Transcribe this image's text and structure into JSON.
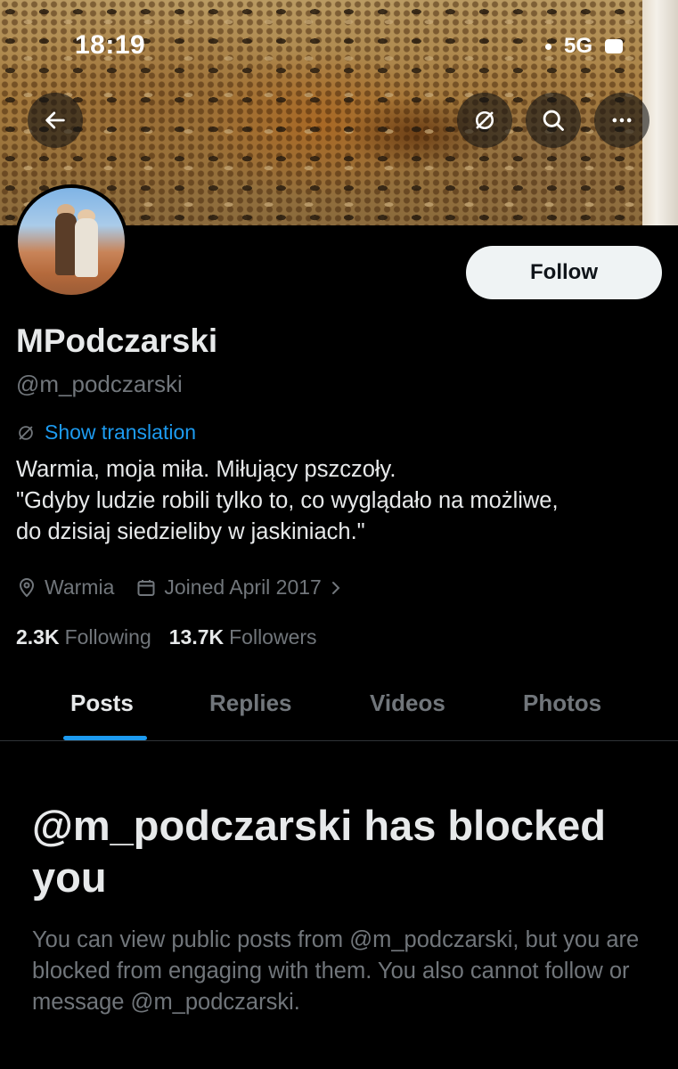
{
  "status_bar": {
    "time": "18:19",
    "network": "5G"
  },
  "profile": {
    "display_name": "MPodczarski",
    "handle": "@m_podczarski",
    "follow_label": "Follow",
    "show_translation": "Show translation",
    "bio_lines": [
      "Warmia, moja miła. Miłujący pszczoły.",
      "\"Gdyby ludzie robili tylko to, co wyglądało na możliwe,",
      "do dzisiaj siedzieliby w jaskiniach.\""
    ],
    "location": "Warmia",
    "joined": "Joined April 2017",
    "following_count": "2.3K",
    "following_label": "Following",
    "followers_count": "13.7K",
    "followers_label": "Followers"
  },
  "tabs": [
    {
      "label": "Posts",
      "active": true
    },
    {
      "label": "Replies",
      "active": false
    },
    {
      "label": "Videos",
      "active": false
    },
    {
      "label": "Photos",
      "active": false
    }
  ],
  "blocked": {
    "title": "@m_podczarski has blocked you",
    "message": "You can view public posts from @m_podczarski, but you are blocked from engaging with them. You also cannot follow or message @m_podczarski."
  },
  "colors": {
    "accent": "#1d9bf0",
    "muted": "#71767b",
    "text": "#e7e9ea",
    "background": "#000000"
  },
  "icons": [
    "back-arrow-icon",
    "translate-icon",
    "search-icon",
    "more-icon",
    "location-icon",
    "calendar-icon",
    "chevron-right-icon"
  ]
}
